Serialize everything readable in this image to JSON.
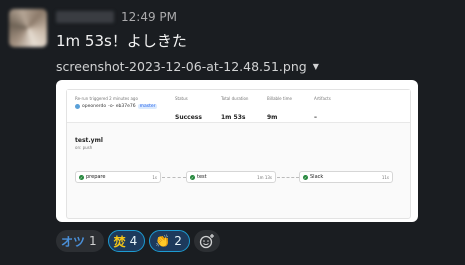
{
  "message": {
    "time": "12:49 PM",
    "text": "1m 53s！よしきた",
    "attachment": {
      "filename": "screenshot-2023-12-06-at-12.48.51.png"
    }
  },
  "ci_run": {
    "trigger_label": "Re-run triggered 2 minutes ago",
    "user": "opeonerdo",
    "commit": "-o- eb37e76",
    "branch": "master",
    "status_label": "Status",
    "status_value": "Success",
    "total_duration_label": "Total duration",
    "total_duration_value": "1m 53s",
    "billable_label": "Billable time",
    "billable_value": "9m",
    "artifacts_label": "Artifacts",
    "artifacts_value": "–",
    "workflow_file": "test.yml",
    "workflow_event": "on: push",
    "jobs": [
      {
        "name": "prepare",
        "duration": "1s"
      },
      {
        "name": "test",
        "duration": "1m 13s"
      },
      {
        "name": "Slack",
        "duration": "11s"
      }
    ]
  },
  "reactions": [
    {
      "emoji": "オツ",
      "emoji_color": "#4a90d9",
      "count": "1",
      "active": false
    },
    {
      "emoji": "焚",
      "emoji_color": "#f5c518",
      "count": "4",
      "active": true
    },
    {
      "emoji": "👏",
      "emoji_color": "#f5c518",
      "count": "2",
      "active": true
    }
  ]
}
